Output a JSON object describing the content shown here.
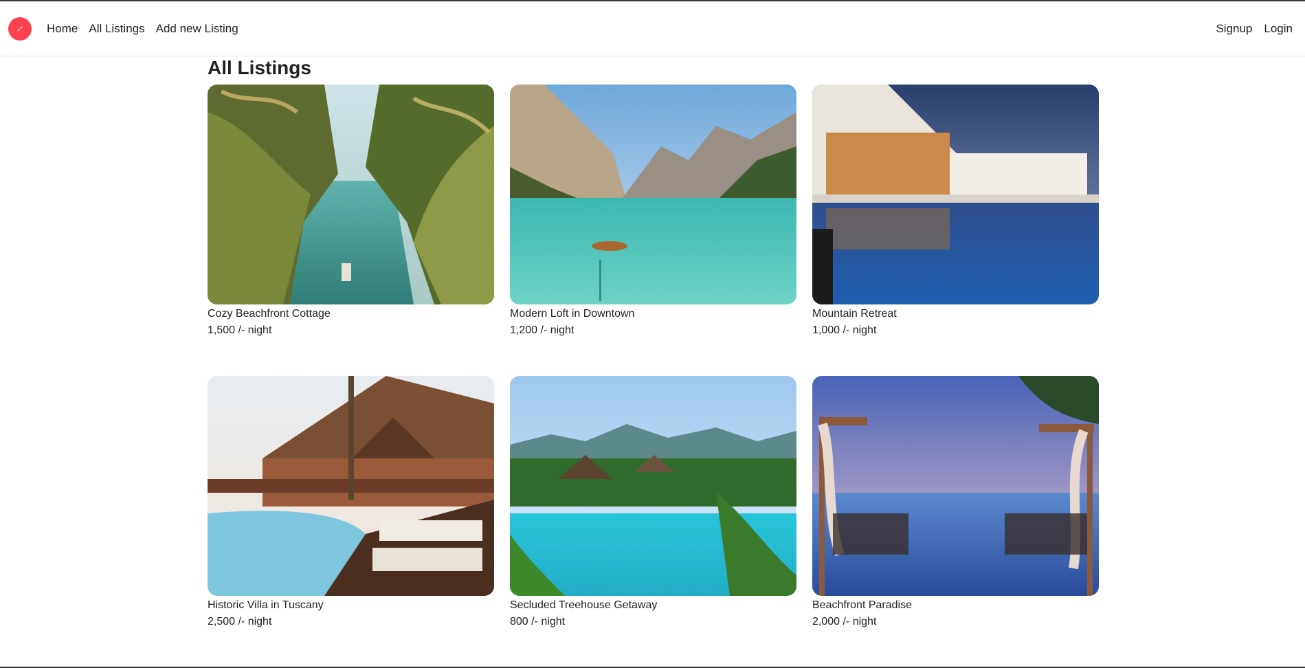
{
  "navbar": {
    "logo_icon": "compass-icon",
    "brand_color": "#fe424d",
    "links_left": [
      "Home",
      "All Listings",
      "Add new Listing"
    ],
    "links_right": [
      "Signup",
      "Login"
    ]
  },
  "page": {
    "title": "All Listings"
  },
  "listings": [
    {
      "title": "Cozy Beachfront Cottage",
      "price": "1,500 /- night",
      "image": "tropical-river-palms-photo"
    },
    {
      "title": "Modern Loft in Downtown",
      "price": "1,200 /- night",
      "image": "mountain-lake-boat-photo"
    },
    {
      "title": "Mountain Retreat",
      "price": "1,000 /- night",
      "image": "resort-pool-night-photo"
    },
    {
      "title": "Historic Villa in Tuscany",
      "price": "2,500 /- night",
      "image": "wooden-villa-pool-photo"
    },
    {
      "title": "Secluded Treehouse Getaway",
      "price": "800 /- night",
      "image": "jungle-resort-pool-photo"
    },
    {
      "title": "Beachfront Paradise",
      "price": "2,000 /- night",
      "image": "infinity-pool-cabanas-photo"
    }
  ]
}
